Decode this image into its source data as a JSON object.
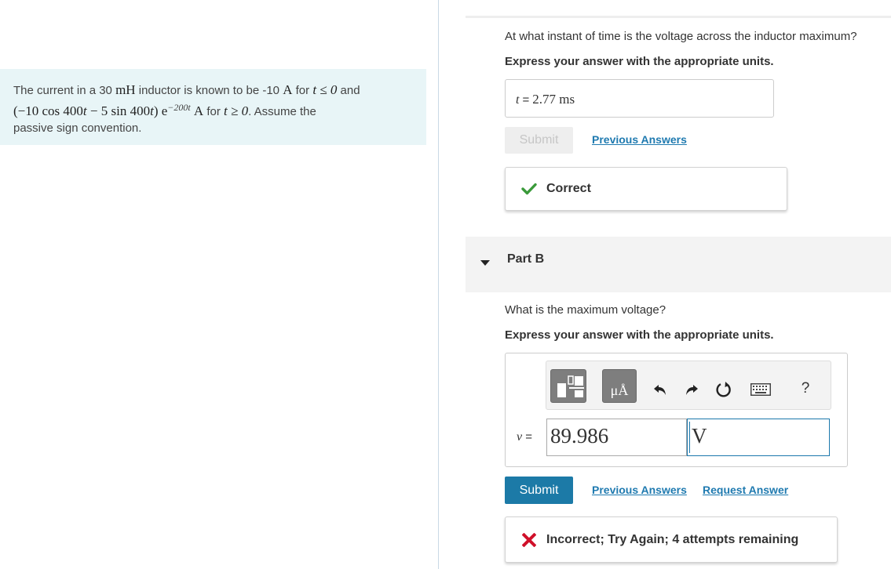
{
  "problem": {
    "text_1": "The current in a 30 ",
    "unit_mH": "mH",
    "text_2": " inductor is known to be -10 ",
    "unit_A": "A",
    "text_3": " for ",
    "cond_1": "t ≤ 0",
    "text_4": " and",
    "expr_open": "(−10 cos 400",
    "expr_mid": " − 5 sin 400",
    "expr_close": ") e",
    "exponent": "−200t",
    "text_5": " for ",
    "cond_2": "t ≥ 0",
    "text_6": ". Assume the",
    "text_7": "passive sign convention."
  },
  "part_a": {
    "question": "At what instant of time is the voltage across the inductor maximum?",
    "instruction": "Express your answer with the appropriate units.",
    "answer_label": "t",
    "equals": "=",
    "answer_value": "2.77 ms",
    "submit_label": "Submit",
    "previous_answers_label": "Previous Answers",
    "feedback_text": "Correct",
    "feedback_color": "#3a9a3a"
  },
  "part_b": {
    "title": "Part B",
    "question": "What is the maximum voltage?",
    "instruction": "Express your answer with the appropriate units.",
    "toolbar": {
      "units_button_label": "μÅ",
      "help_label": "?"
    },
    "answer_label": "v",
    "equals": "=",
    "value_input": "89.986",
    "unit_input": "V",
    "submit_label": "Submit",
    "previous_answers_label": "Previous Answers",
    "request_answer_label": "Request Answer",
    "feedback_text": "Incorrect; Try Again; 4 attempts remaining",
    "feedback_color": "#d0102a"
  },
  "colors": {
    "accent": "#1c7aa7",
    "link": "#1f7ab0",
    "problem_bg": "#e8f5f7"
  }
}
